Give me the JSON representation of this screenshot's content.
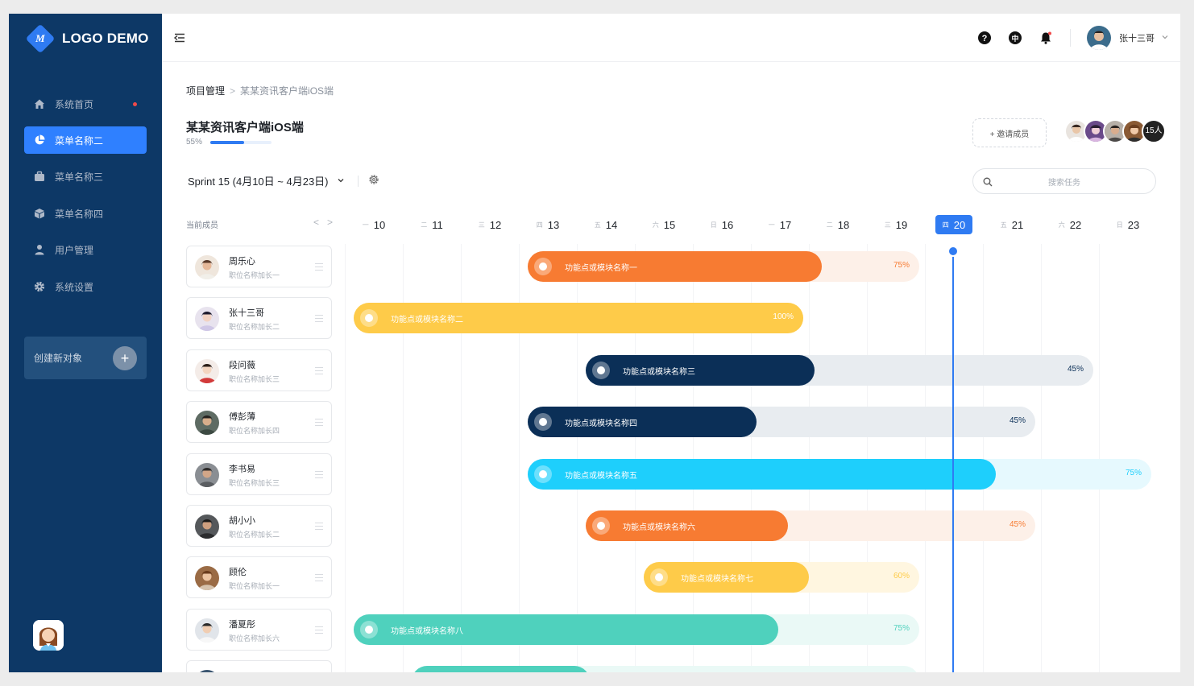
{
  "sidebar": {
    "logo": "LOGO DEMO",
    "logo_mark": "M",
    "items": [
      {
        "label": "系统首页",
        "icon": "home-icon",
        "dot": true
      },
      {
        "label": "菜单名称二",
        "icon": "pie-chart-icon",
        "active": true
      },
      {
        "label": "菜单名称三",
        "icon": "briefcase-icon"
      },
      {
        "label": "菜单名称四",
        "icon": "box-icon"
      },
      {
        "label": "用户管理",
        "icon": "user-icon"
      },
      {
        "label": "系统设置",
        "icon": "gear-icon"
      }
    ],
    "create_label": "创建新对象",
    "create_plus": "+"
  },
  "topbar": {
    "icons": [
      "help-icon",
      "language-icon",
      "bell-icon"
    ],
    "lang_glyph": "中",
    "user_name": "张十三哥"
  },
  "breadcrumb": {
    "root": "项目管理",
    "separator": ">",
    "current": "某某资讯客户端iOS端"
  },
  "project": {
    "title": "某某资讯客户端iOS端",
    "progress_label": "55%",
    "progress": 0.55
  },
  "invite_label": "+ 邀请成员",
  "avatars_count_label": "15人",
  "sprint_label": "Sprint 15 (4月10日 ~ 4月23日)",
  "search": {
    "placeholder": "搜索任务"
  },
  "members_header": "当前成员",
  "nav_prev": "<",
  "nav_next": ">",
  "days": [
    {
      "w": "一",
      "d": "10"
    },
    {
      "w": "二",
      "d": "11"
    },
    {
      "w": "三",
      "d": "12"
    },
    {
      "w": "四",
      "d": "13"
    },
    {
      "w": "五",
      "d": "14"
    },
    {
      "w": "六",
      "d": "15"
    },
    {
      "w": "日",
      "d": "16"
    },
    {
      "w": "一",
      "d": "17"
    },
    {
      "w": "二",
      "d": "18"
    },
    {
      "w": "三",
      "d": "19"
    },
    {
      "w": "四",
      "d": "20",
      "today": true
    },
    {
      "w": "五",
      "d": "21"
    },
    {
      "w": "六",
      "d": "22"
    },
    {
      "w": "日",
      "d": "23"
    }
  ],
  "members": [
    {
      "name": "周乐心",
      "role": "职位名称加长一"
    },
    {
      "name": "张十三哥",
      "role": "职位名称加长二"
    },
    {
      "name": "段问薇",
      "role": "职位名称加长三"
    },
    {
      "name": "傅彭薄",
      "role": "职位名称加长四"
    },
    {
      "name": "李书易",
      "role": "职位名称加长三"
    },
    {
      "name": "胡小小",
      "role": "职位名称加长二"
    },
    {
      "name": "顾伦",
      "role": "职位名称加长一"
    },
    {
      "name": "潘夏彤",
      "role": "职位名称加长六"
    },
    {
      "name": "",
      "role": ""
    }
  ],
  "tasks": [
    {
      "label": "功能点或模块名称一",
      "percent_label": "75%",
      "progress": 0.75,
      "start_day": "13",
      "end_day": "19",
      "color": "#f77b32",
      "track": "#fdf0e8",
      "pct_color": "#f77b32"
    },
    {
      "label": "功能点或模块名称二",
      "percent_label": "100%",
      "progress": 1.0,
      "start_day": "10",
      "end_day": "17",
      "color": "#fecb49",
      "track": "#fff6e0",
      "pct_color": "#ffffff"
    },
    {
      "label": "功能点或模块名称三",
      "percent_label": "45%",
      "progress": 0.45,
      "start_day": "14",
      "end_day": "22",
      "color": "#0b2f57",
      "track": "#e8ecf0",
      "pct_color": "#0b2f57"
    },
    {
      "label": "功能点或模块名称四",
      "percent_label": "45%",
      "progress": 0.45,
      "start_day": "13",
      "end_day": "21",
      "color": "#0b2f57",
      "track": "#e8ecf0",
      "pct_color": "#0b2f57"
    },
    {
      "label": "功能点或模块名称五",
      "percent_label": "75%",
      "progress": 0.75,
      "start_day": "13",
      "end_day": "23",
      "color": "#1ecffc",
      "track": "#e6f9fe",
      "pct_color": "#1ecffc"
    },
    {
      "label": "功能点或模块名称六",
      "percent_label": "45%",
      "progress": 0.45,
      "start_day": "14",
      "end_day": "21",
      "color": "#f77b32",
      "track": "#fdf0e8",
      "pct_color": "#f77b32"
    },
    {
      "label": "功能点或模块名称七",
      "percent_label": "60%",
      "progress": 0.6,
      "start_day": "15",
      "end_day": "19",
      "color": "#fecb49",
      "track": "#fff6e0",
      "pct_color": "#fecb49"
    },
    {
      "label": "功能点或模块名称八",
      "percent_label": "75%",
      "progress": 0.75,
      "start_day": "10",
      "end_day": "19",
      "color": "#4fd1bd",
      "track": "#eaf9f6",
      "pct_color": "#4fd1bd"
    },
    {
      "label": "",
      "percent_label": "",
      "progress": 0.35,
      "start_day": "11",
      "end_day": "19",
      "color": "#4fd1bd",
      "track": "#eaf9f6",
      "pct_color": "#4fd1bd"
    }
  ],
  "colors": {
    "sidebar": "#0d3866",
    "accent": "#2f7bf2",
    "today": "#2f7bf2"
  }
}
